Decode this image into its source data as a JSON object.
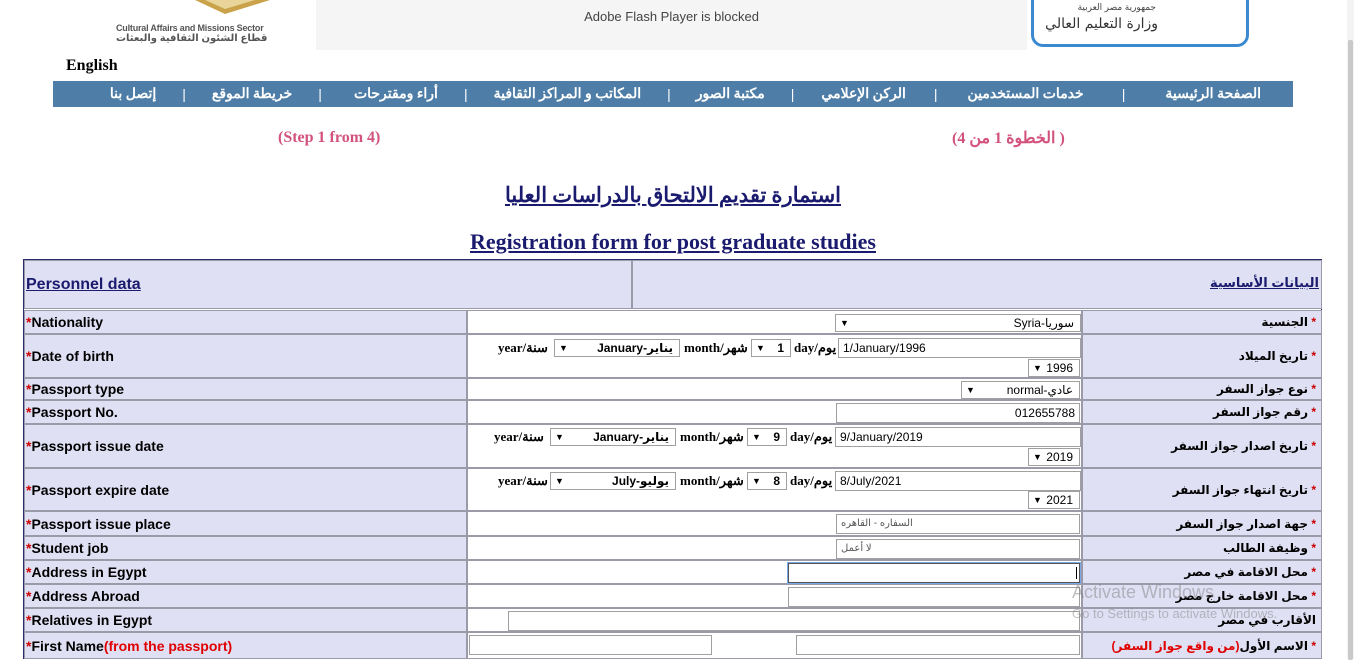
{
  "header": {
    "logo_left_line1": "Cultural Affairs and Missions Sector",
    "logo_left_line2": "قطاع الشئون الثقافية والبعثات",
    "flash_notice": "Adobe Flash Player is blocked",
    "logo_right_line1": "جمهورية مصر العربية",
    "logo_right_line2": "وزارة التعليم العالي",
    "language_link": "English"
  },
  "nav": {
    "items": [
      "الصفحة الرئيسية",
      "خدمات المستخدمين",
      "الركن الإعلامي",
      "مكتبة الصور",
      "المكاتب و المراكز الثقافية",
      "أراء ومقترحات",
      "خريطة الموقع",
      "إتصل بنا"
    ],
    "separator": "|"
  },
  "steps": {
    "en": "(Step 1 from 4)",
    "ar": "( الخطوة 1 من 4)"
  },
  "titles": {
    "ar": "استمارة تقديم الالتحاق بالدراسات العليا",
    "en": "Registration form for post graduate studies"
  },
  "form": {
    "section_en": "Personnel data",
    "section_ar": "البيانات الأساسية",
    "star": "*",
    "date_labels": {
      "day": "day",
      "day_ar": "يوم/",
      "month": "month",
      "month_ar": "شهر/",
      "year": "year",
      "year_ar": "سنة/"
    },
    "rows": {
      "nationality": {
        "en": "Nationality",
        "ar": "الجنسية",
        "value": "Syria-سوريا"
      },
      "dob": {
        "en": "Date of birth",
        "ar": "تاريخ الميلاد",
        "text": "1/January/1996",
        "day": "1",
        "month": "January-يناير",
        "year": "1996"
      },
      "passport_type": {
        "en": "Passport type",
        "ar": "نوع جواز السفر",
        "value": "normal-عادي"
      },
      "passport_no": {
        "en": "Passport No.",
        "ar": "رقم جواز السفر",
        "value": "012655788"
      },
      "issue_date": {
        "en": "Passport issue date",
        "ar": "تاريخ اصدار جواز السفر",
        "text": "9/January/2019",
        "day": "9",
        "month": "January-يناير",
        "year": "2019"
      },
      "expire_date": {
        "en": "Passport expire date",
        "ar": "تاريخ انتهاء جواز السفر",
        "text": "8/July/2021",
        "day": "8",
        "month": "July-يوليو",
        "year": "2021"
      },
      "issue_place": {
        "en": "Passport issue place",
        "ar": "جهة اصدار جواز السفر",
        "value": "السفاره - القاهره"
      },
      "job": {
        "en": "Student job",
        "ar": "وظيفة الطالب",
        "value": "لا أعمل"
      },
      "address_egypt": {
        "en": "Address in Egypt",
        "ar": "محل الاقامة في مصر",
        "value": ""
      },
      "address_abroad": {
        "en": "Address Abroad",
        "ar": "محل الاقامة خارج مصر",
        "value": ""
      },
      "relatives": {
        "en": "Relatives in Egypt",
        "ar": "الأقارب في مصر",
        "value": ""
      },
      "first_name": {
        "en": "First Name",
        "en_note": "(from the passport)",
        "ar": "الاسم الأول",
        "ar_note": "(من واقع جواز السفر)"
      }
    }
  },
  "watermark": {
    "line1": "Activate Windows",
    "line2": "Go to Settings to activate Windows."
  }
}
